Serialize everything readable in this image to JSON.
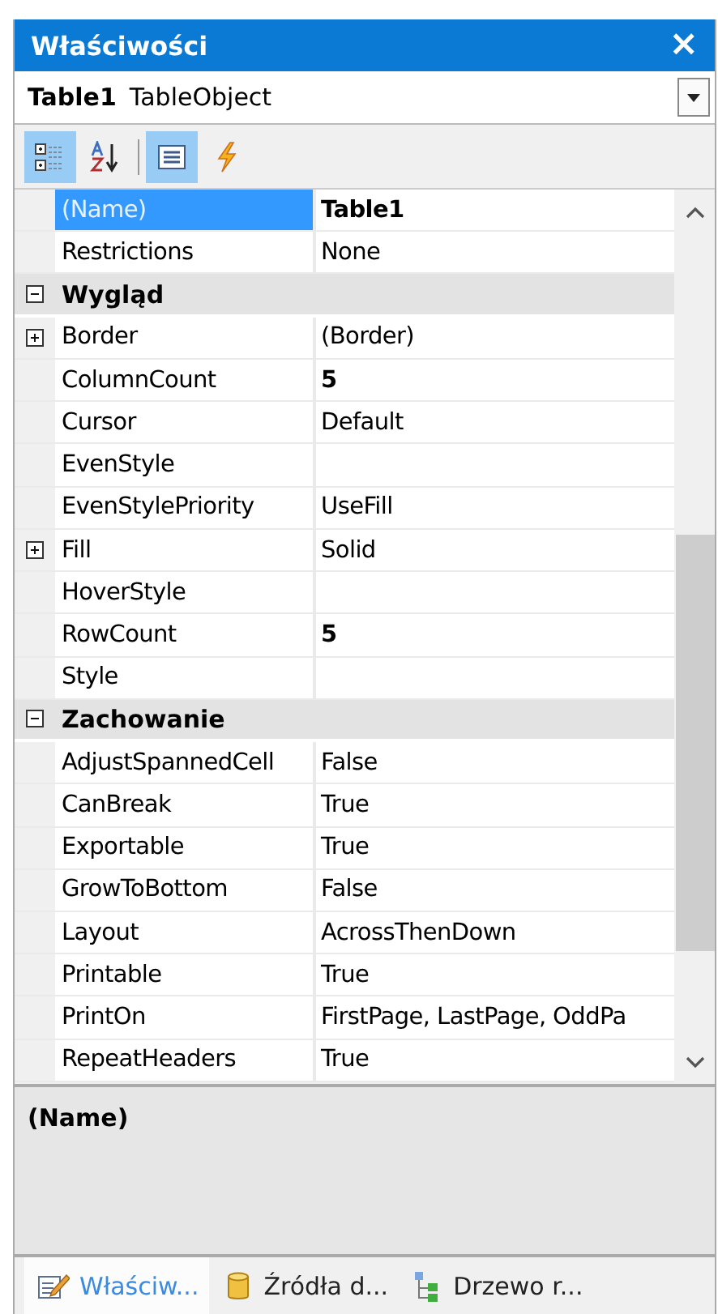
{
  "window": {
    "title": "Właściwości",
    "close": "×"
  },
  "object_selector": {
    "name": "Table1",
    "type": "TableObject"
  },
  "toolbar": [
    {
      "kind": "categorized",
      "selected": true
    },
    {
      "kind": "alphabetical",
      "selected": false
    },
    {
      "kind": "separator"
    },
    {
      "kind": "properties",
      "selected": true
    },
    {
      "kind": "events",
      "selected": false
    }
  ],
  "grid": [
    {
      "kind": "property",
      "name": "(Name)",
      "value": "Table1",
      "bold": true,
      "selected": true,
      "collapsed": false
    },
    {
      "kind": "property",
      "name": "Restrictions",
      "value": "None",
      "bold": false,
      "selected": false,
      "collapsed": false
    },
    {
      "kind": "category",
      "name": "Wygląd",
      "expanded": true
    },
    {
      "kind": "property",
      "name": "Border",
      "value": "(Border)",
      "bold": false,
      "selected": false,
      "collapsed": true
    },
    {
      "kind": "property",
      "name": "ColumnCount",
      "value": "5",
      "bold": true,
      "selected": false,
      "collapsed": false
    },
    {
      "kind": "property",
      "name": "Cursor",
      "value": "Default",
      "bold": false,
      "selected": false,
      "collapsed": false
    },
    {
      "kind": "property",
      "name": "EvenStyle",
      "selected": false,
      "collapsed": false
    },
    {
      "kind": "property",
      "name": "EvenStylePriority",
      "value": "UseFill",
      "bold": false,
      "selected": false,
      "collapsed": false
    },
    {
      "kind": "property",
      "name": "Fill",
      "value": "Solid",
      "bold": false,
      "selected": false,
      "collapsed": true
    },
    {
      "kind": "property",
      "name": "HoverStyle",
      "selected": false,
      "collapsed": false
    },
    {
      "kind": "property",
      "name": "RowCount",
      "value": "5",
      "bold": true,
      "selected": false,
      "collapsed": false
    },
    {
      "kind": "property",
      "name": "Style",
      "selected": false,
      "collapsed": false
    },
    {
      "kind": "category",
      "name": "Zachowanie",
      "expanded": true
    },
    {
      "kind": "property",
      "name": "AdjustSpannedCell",
      "value": "False",
      "bold": false,
      "selected": false,
      "collapsed": false
    },
    {
      "kind": "property",
      "name": "CanBreak",
      "value": "True",
      "bold": false,
      "selected": false,
      "collapsed": false
    },
    {
      "kind": "property",
      "name": "Exportable",
      "value": "True",
      "bold": false,
      "selected": false,
      "collapsed": false
    },
    {
      "kind": "property",
      "name": "GrowToBottom",
      "value": "False",
      "bold": false,
      "selected": false,
      "collapsed": false
    },
    {
      "kind": "property",
      "name": "Layout",
      "value": "AcrossThenDown",
      "bold": false,
      "selected": false,
      "collapsed": false
    },
    {
      "kind": "property",
      "name": "Printable",
      "value": "True",
      "bold": false,
      "selected": false,
      "collapsed": false
    },
    {
      "kind": "property",
      "name": "PrintOn",
      "value": "FirstPage, LastPage, OddPa",
      "bold": false,
      "selected": false,
      "collapsed": false
    },
    {
      "kind": "property",
      "name": "RepeatHeaders",
      "value": "True",
      "bold": false,
      "selected": false,
      "collapsed": false
    }
  ],
  "description": {
    "title": "(Name)"
  },
  "tabs": [
    {
      "label": "Właściw...",
      "selected": true
    },
    {
      "label": "Źródła d...",
      "selected": false
    },
    {
      "label": "Drzewo r...",
      "selected": false
    }
  ]
}
